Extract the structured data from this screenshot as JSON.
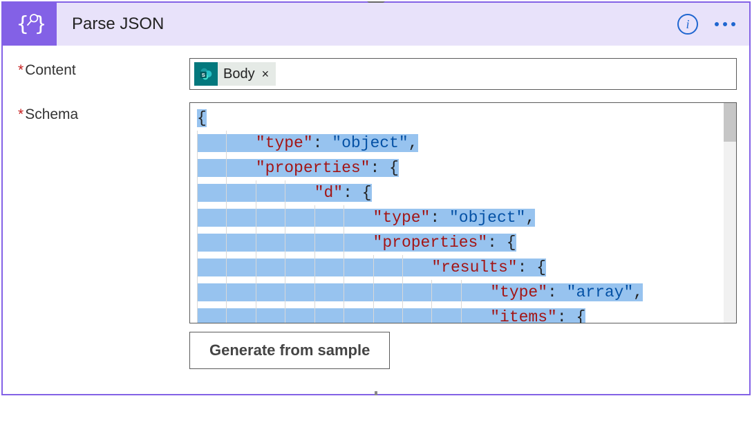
{
  "header": {
    "title": "Parse JSON",
    "info_label": "i"
  },
  "content": {
    "label": "Content",
    "token_label": "Body",
    "token_remove": "×"
  },
  "schema": {
    "label": "Schema",
    "lines": [
      {
        "indent": 0,
        "tokens": [
          {
            "t": "punct",
            "v": "{"
          }
        ]
      },
      {
        "indent": 2,
        "tokens": [
          {
            "t": "key",
            "v": "\"type\""
          },
          {
            "t": "punct",
            "v": ": "
          },
          {
            "t": "str",
            "v": "\"object\""
          },
          {
            "t": "punct",
            "v": ","
          }
        ]
      },
      {
        "indent": 2,
        "tokens": [
          {
            "t": "key",
            "v": "\"properties\""
          },
          {
            "t": "punct",
            "v": ": {"
          }
        ]
      },
      {
        "indent": 4,
        "tokens": [
          {
            "t": "key",
            "v": "\"d\""
          },
          {
            "t": "punct",
            "v": ": {"
          }
        ]
      },
      {
        "indent": 6,
        "tokens": [
          {
            "t": "key",
            "v": "\"type\""
          },
          {
            "t": "punct",
            "v": ": "
          },
          {
            "t": "str",
            "v": "\"object\""
          },
          {
            "t": "punct",
            "v": ","
          }
        ]
      },
      {
        "indent": 6,
        "tokens": [
          {
            "t": "key",
            "v": "\"properties\""
          },
          {
            "t": "punct",
            "v": ": {"
          }
        ]
      },
      {
        "indent": 8,
        "tokens": [
          {
            "t": "key",
            "v": "\"results\""
          },
          {
            "t": "punct",
            "v": ": {"
          }
        ]
      },
      {
        "indent": 10,
        "tokens": [
          {
            "t": "key",
            "v": "\"type\""
          },
          {
            "t": "punct",
            "v": ": "
          },
          {
            "t": "str",
            "v": "\"array\""
          },
          {
            "t": "punct",
            "v": ","
          }
        ]
      },
      {
        "indent": 10,
        "tokens": [
          {
            "t": "key",
            "v": "\"items\""
          },
          {
            "t": "punct",
            "v": ": {"
          }
        ]
      }
    ]
  },
  "generate_button": "Generate from sample"
}
